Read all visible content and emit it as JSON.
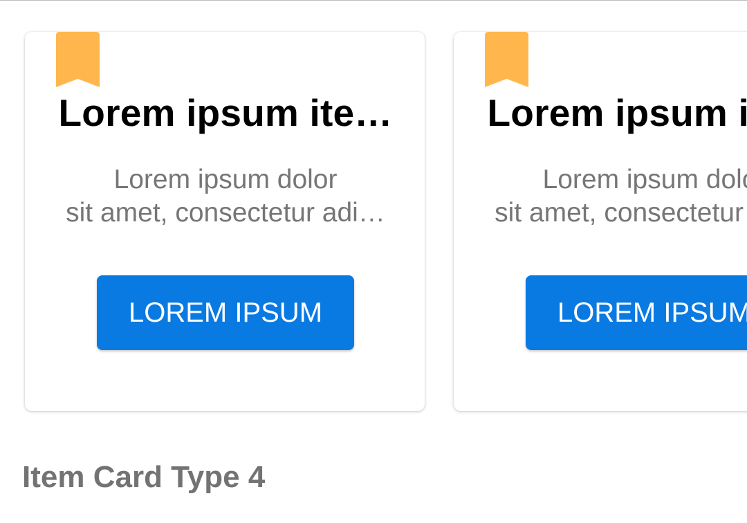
{
  "colors": {
    "bookmark": "#ffb74d",
    "button": "#0a7ae3",
    "title": "#000000",
    "description": "#767676",
    "section_heading": "#737373"
  },
  "cards": [
    {
      "bookmark_icon": "bookmark-ribbon-icon",
      "title": "Lorem ipsum ite…",
      "description_line1": "Lorem ipsum dolor",
      "description_line2": "sit amet, consectetur adi…",
      "button_label": "LOREM IPSUM"
    },
    {
      "bookmark_icon": "bookmark-ribbon-icon",
      "title": "Lorem ipsum ite…",
      "description_line1": "Lorem ipsum dolor",
      "description_line2": "sit amet, consectetur adi…",
      "button_label": "LOREM IPSUM"
    }
  ],
  "section_heading": "Item Card Type 4"
}
